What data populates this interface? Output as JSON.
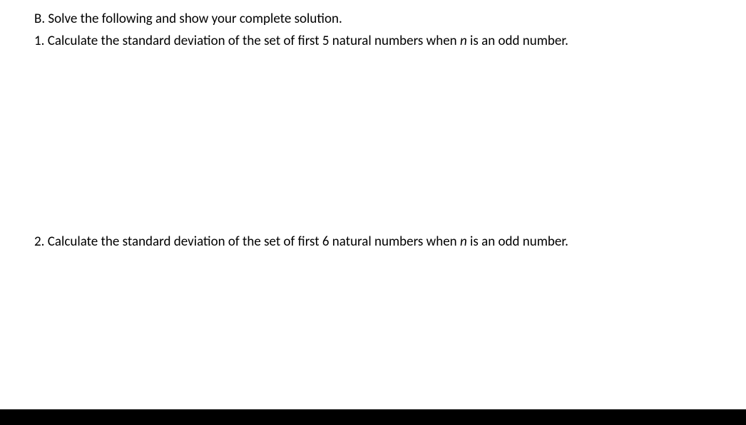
{
  "section": {
    "label": "B. Solve the following and show your complete solution."
  },
  "questions": {
    "q1": {
      "prefix": "1. Calculate the standard deviation of the set of first 5 natural numbers when ",
      "var": "n",
      "suffix": " is an odd number."
    },
    "q2": {
      "prefix": "2. Calculate the standard deviation of the set of first 6 natural numbers when ",
      "var": "n",
      "suffix": " is an odd number."
    }
  }
}
